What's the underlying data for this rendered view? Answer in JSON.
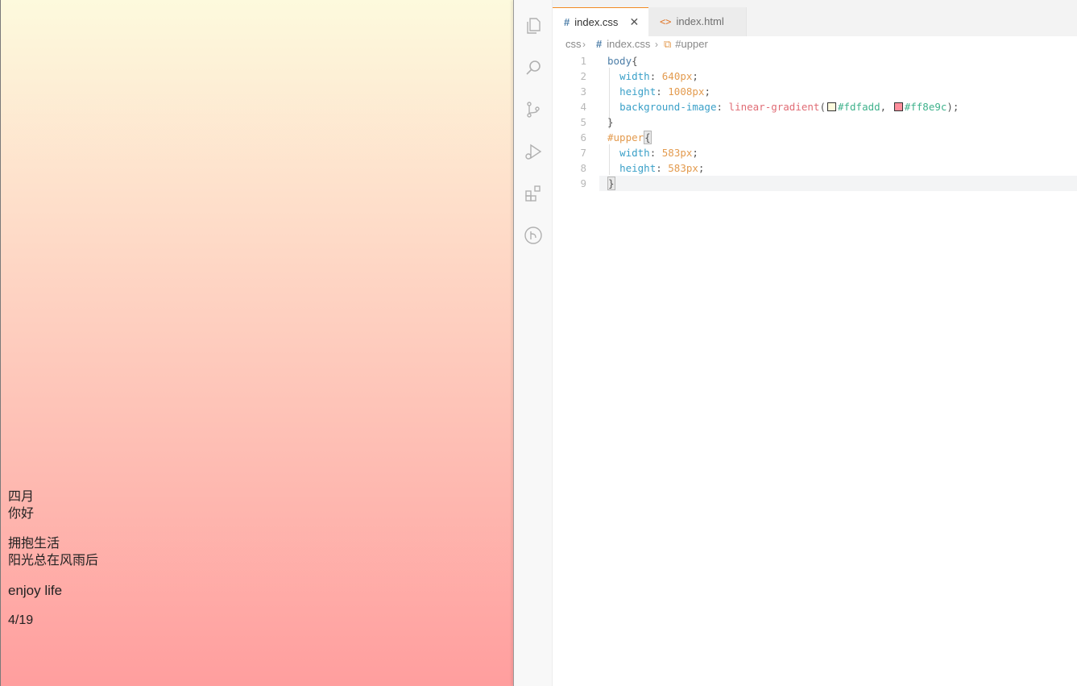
{
  "preview": {
    "lines": [
      "四月",
      "你好",
      "拥抱生活",
      "阳光总在风雨后",
      "enjoy life",
      "4/19"
    ],
    "gradient_start": "#fdfadd",
    "gradient_end": "#ff9e9e"
  },
  "activity_bar": {
    "icons": [
      "files-icon",
      "search-icon",
      "source-control-icon",
      "run-debug-icon",
      "extensions-icon",
      "git-graph-icon"
    ]
  },
  "tabs": [
    {
      "label": "index.css",
      "icon": "#",
      "active": true
    },
    {
      "label": "index.html",
      "icon": "<>",
      "active": false
    }
  ],
  "breadcrumbs": {
    "folder": "css",
    "file": "index.css",
    "symbol": "#upper"
  },
  "editor": {
    "line_numbers": [
      "1",
      "2",
      "3",
      "4",
      "5",
      "6",
      "7",
      "8",
      "9"
    ],
    "lines": [
      {
        "selector": "body",
        "open": "{"
      },
      {
        "prop": "width",
        "value": "640px"
      },
      {
        "prop": "height",
        "value": "1008px"
      },
      {
        "prop": "background-image",
        "fn": "linear-gradient",
        "color1": "#fdfadd",
        "color2": "#ff8e9c"
      },
      {
        "close": "}"
      },
      {
        "selector": "#upper",
        "open": "{"
      },
      {
        "prop": "width",
        "value": "583px"
      },
      {
        "prop": "height",
        "value": "583px"
      },
      {
        "close": "}"
      }
    ]
  }
}
